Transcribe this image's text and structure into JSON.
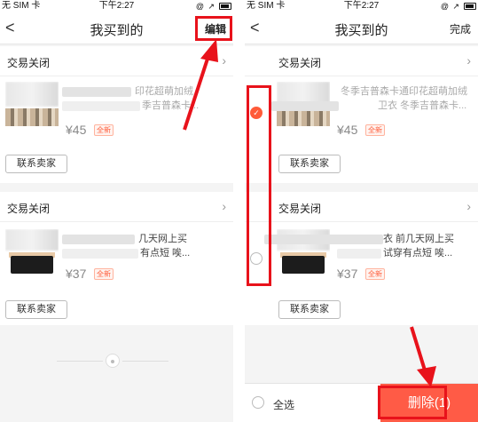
{
  "status_bar": {
    "carrier": "无 SIM 卡",
    "time": "下午2:27",
    "icons": "@ ↗"
  },
  "header": {
    "back": "<",
    "title": "我买到的",
    "edit_label": "编辑",
    "done_label": "完成"
  },
  "orders": [
    {
      "status": "交易关闭",
      "title_visible": "印花超萌加绒",
      "title_visible_right": "冬季吉普森卡通印花超萌加绒",
      "title_line2_right": "卫衣 冬季吉普森卡...",
      "title_line2_left": "季吉普森卡...",
      "price": "¥45",
      "condition": "全新",
      "contact_label": "联系卖家"
    },
    {
      "status": "交易关闭",
      "title_visible": "几天网上买",
      "title_line2": "有点短 唉...",
      "title_visible_right": "衣 前几天网上买",
      "title_line2_right": "试穿有点短 唉...",
      "price": "¥37",
      "condition": "全新",
      "contact_label": "联系卖家"
    }
  ],
  "bottom_bar": {
    "select_all_label": "全选",
    "delete_label": "删除(1)"
  },
  "colors": {
    "accent": "#ff5b46",
    "highlight": "#e8121b",
    "badge_text": "#ff5b39"
  }
}
